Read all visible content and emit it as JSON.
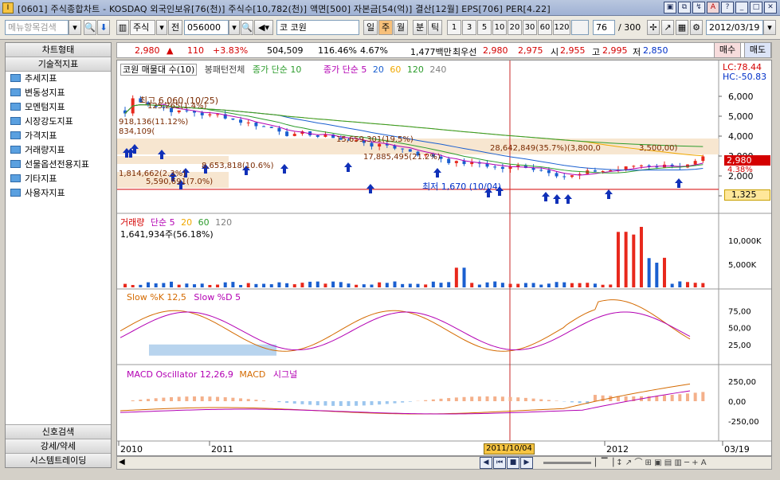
{
  "window": {
    "title": "[0601] 주식종합차트 - KOSDAQ 외국인보유[76(천)] 주식수[10,782(천)] 액면[500] 자본금[54(억)] 결산[12월] EPS[706] PER[4.22]",
    "icon": "chart-app-icon"
  },
  "toolbar": {
    "menu_search_placeholder": "메뉴항목검색",
    "market_label": "주식",
    "prev_label": "전",
    "code_value": "056000",
    "market_tag": "코",
    "stock_name": "코원",
    "period_buttons": [
      "일",
      "주",
      "월"
    ],
    "selected_period": "주",
    "minute_buttons": [
      "분",
      "틱"
    ],
    "interval_buttons": [
      "1",
      "3",
      "5",
      "10",
      "20",
      "30",
      "60",
      "120"
    ],
    "count_value": "76",
    "count_total": "/ 300",
    "date_value": "2012/03/19",
    "buy_label": "매수",
    "sell_label": "매도"
  },
  "sidebar": {
    "header": "차트형태",
    "section": "기술적지표",
    "items": [
      "추세지표",
      "변동성지표",
      "모멘텀지표",
      "시장강도지표",
      "가격지표",
      "거래량지표",
      "선물옵션전용지표",
      "기타지표",
      "사용자지표"
    ],
    "bottom": [
      "신호검색",
      "강세/약세",
      "시스템트레이딩"
    ]
  },
  "quote": {
    "price": "2,980",
    "change": "110",
    "change_pct": "+3.83%",
    "volume": "504,509",
    "vol_ratio": "116.46%",
    "turnover": "4.67%",
    "amount": "1,477백만",
    "best_label": "최우선",
    "best_ask": "2,980",
    "best_bid": "2,975",
    "open_label": "시",
    "open": "2,955",
    "high_label": "고",
    "high": "2,995",
    "low_label": "저",
    "low": "2,850"
  },
  "price_panel": {
    "legend": [
      "코원 매물대 수(10)",
      "봉패턴전체",
      "종가 단순 10",
      "종가 단순 5",
      "20",
      "60",
      "120",
      "240"
    ],
    "lc": "LC:78.44",
    "hc": "HC:-50.83",
    "y_ticks": [
      "6,000",
      "5,000",
      "4,000",
      "3,000",
      "2,000",
      "1,000"
    ],
    "current_price_tag": "2,980",
    "current_pct_tag": "4.38%",
    "line_tag": "1,325",
    "annotations": {
      "high": "최고 6,060 (10/25)",
      "low": "최저 1,670 (10/04)",
      "vp1": "125,265(1.4%)",
      "vp2": "918,136(11.12%)",
      "vp3": "834,109(",
      "vp4": "15,659,301(19.5%)",
      "vp5": "17,885,495(21.2%)",
      "vp6": "28,642,849(35.7%)(3,800,0",
      "vp7": "3,500,00)",
      "vp8": "8,653,818(10.6%)",
      "vp9": "1,814,662(2.3%)",
      "vp10": "5,590,691(7.0%)"
    }
  },
  "volume_panel": {
    "legend": [
      "거래량",
      "단순 5",
      "20",
      "60",
      "120"
    ],
    "value": "1,641,934주(56.18%)",
    "y_ticks": [
      "10,000K",
      "5,000K"
    ]
  },
  "stoch_panel": {
    "legend": [
      "Slow %K 12,5",
      "Slow %D 5"
    ],
    "y_ticks": [
      "75,00",
      "50,00",
      "25,00"
    ]
  },
  "macd_panel": {
    "legend": [
      "MACD Oscillator 12,26,9",
      "MACD",
      "시그널"
    ],
    "y_ticks": [
      "250,00",
      "0,00",
      "-250,00"
    ]
  },
  "x_axis": {
    "labels": [
      "2010",
      "2011",
      "2012",
      "03/19"
    ],
    "cursor_date": "2011/10/04"
  },
  "colors": {
    "up": "#e8281c",
    "down": "#1a5fd0",
    "ma5": "#b300b3",
    "ma20": "#f0a800",
    "ma60": "#2c9c2c",
    "ma120": "#808080"
  }
}
